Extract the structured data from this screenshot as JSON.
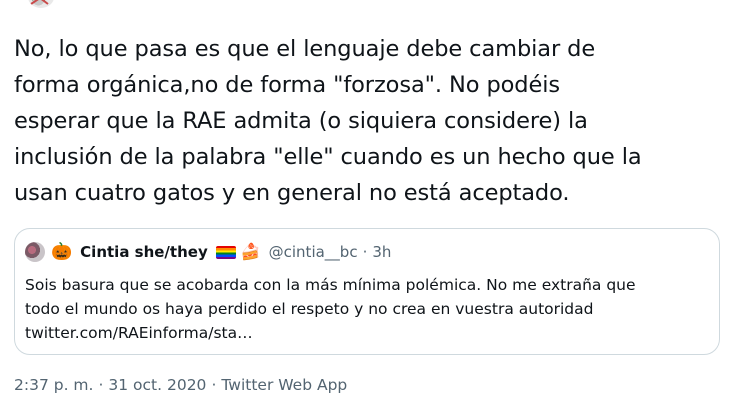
{
  "tweet": {
    "text": "No, lo que pasa es que el lenguaje debe cambiar de\nforma orgánica,no de forma \"forzosa\". No podéis\nesperar que la RAE admita (o siquiera considere) la\ninclusión de la palabra \"elle\" cuando es un hecho que la\nusan cuatro gatos y en general no está aceptado."
  },
  "quoted_tweet": {
    "display_name": "Cintia she/they",
    "name_emoji_prefix": "🎃",
    "name_emoji_suffix": "🍰",
    "flag_icon": "rainbow-flag-icon",
    "handle": "@cintia__bc",
    "separator": "·",
    "time_ago": "3h",
    "text": "Sois basura que se acobarda con la más mínima polémica. No me extraña que\ntodo el mundo os haya perdido el respeto y no crea en vuestra autoridad\ntwitter.com/RAEinforma/sta…"
  },
  "footer": {
    "time": "2:37 p. m.",
    "separator1": "·",
    "date": "31 oct. 2020",
    "separator2": "·",
    "source": "Twitter Web App"
  },
  "colors": {
    "text": "#0f1419",
    "secondary": "#536471",
    "border": "#cfd9de"
  }
}
